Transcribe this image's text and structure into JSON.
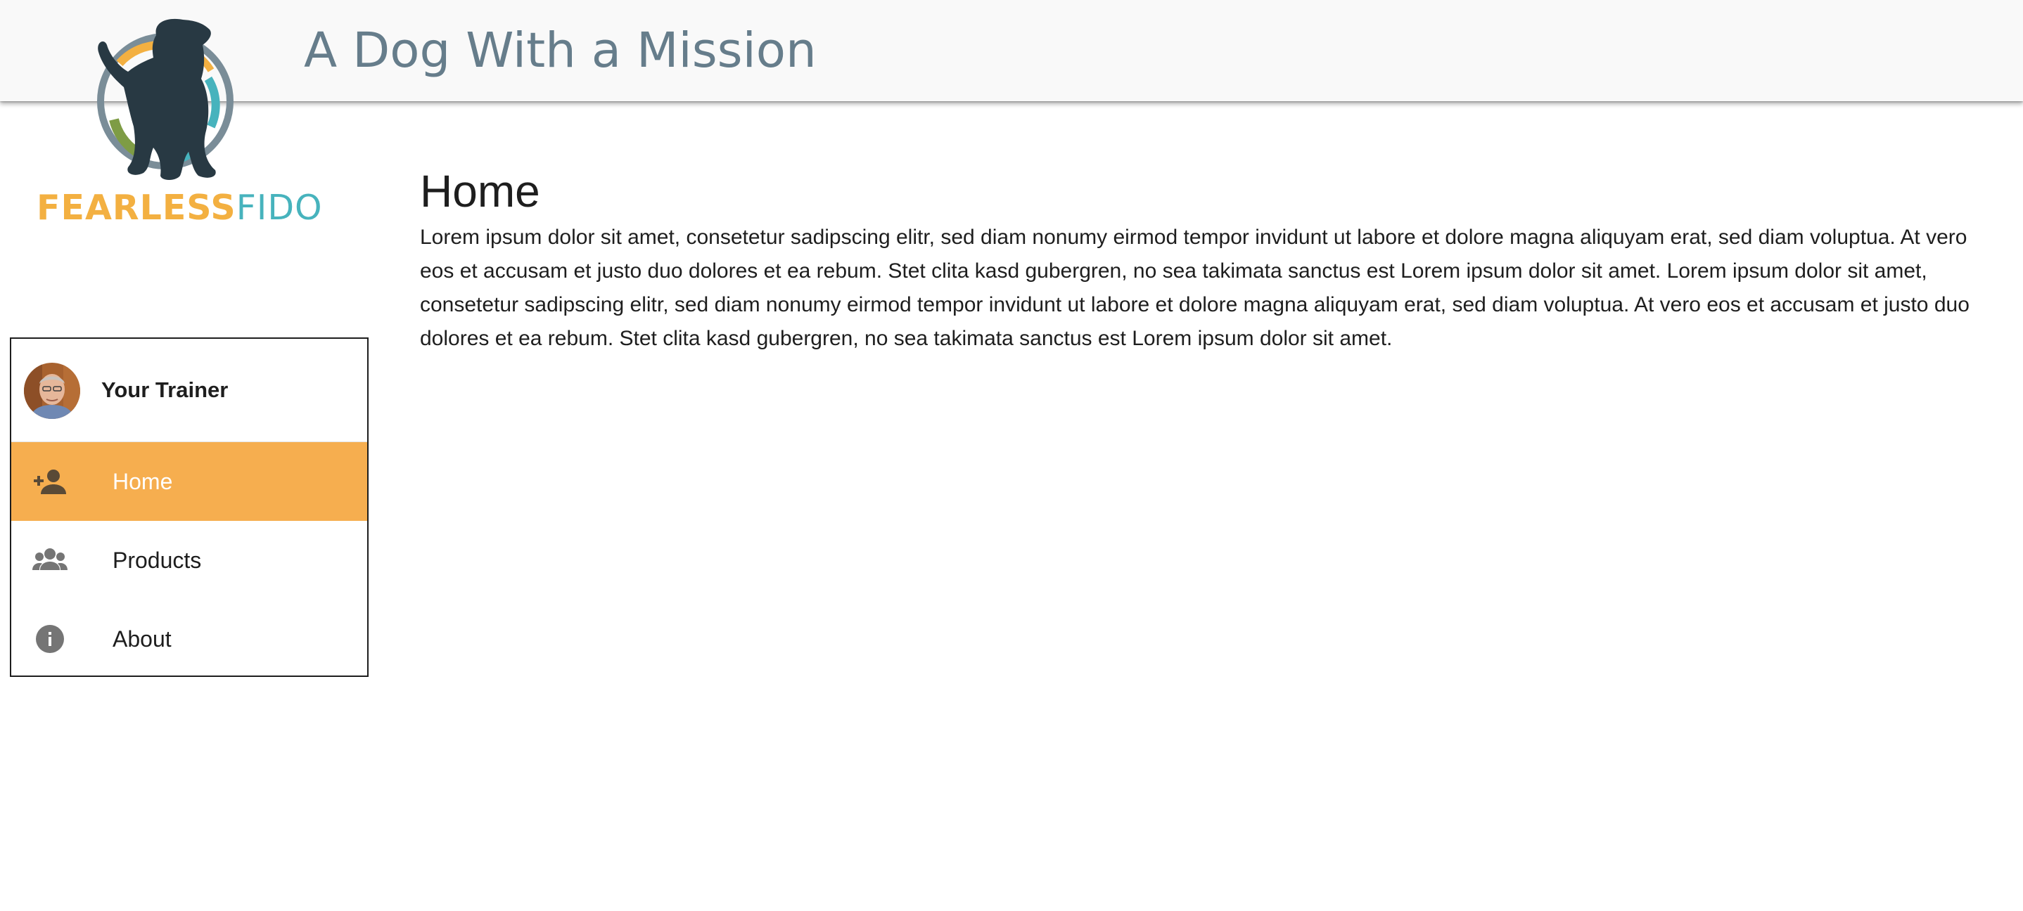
{
  "header": {
    "title": "A Dog With a Mission"
  },
  "logo": {
    "icon": "dog-silhouette-logo-icon",
    "word_fearless": "FEARLESS",
    "word_fido": "FIDO",
    "colors": {
      "dog": "#283943",
      "ring": "#7a8d98",
      "orange": "#f3b041",
      "teal": "#47b3bd",
      "green": "#7e9c45"
    }
  },
  "sidebar": {
    "trainer_label": "Your Trainer",
    "items": [
      {
        "label": "Home",
        "icon": "person-add-icon",
        "active": true
      },
      {
        "label": "Products",
        "icon": "group-icon",
        "active": false
      },
      {
        "label": "About",
        "icon": "info-icon",
        "active": false
      }
    ]
  },
  "main": {
    "title": "Home",
    "body": "Lorem ipsum dolor sit amet, consetetur sadipscing elitr, sed diam nonumy eirmod tempor invidunt ut labore et dolore magna aliquyam erat, sed diam voluptua. At vero eos et accusam et justo duo dolores et ea rebum. Stet clita kasd gubergren, no sea takimata sanctus est Lorem ipsum dolor sit amet. Lorem ipsum dolor sit amet, consetetur sadipscing elitr, sed diam nonumy eirmod tempor invidunt ut labore et dolore magna aliquyam erat, sed diam voluptua. At vero eos et accusam et justo duo dolores et ea rebum. Stet clita kasd gubergren, no sea takimata sanctus est Lorem ipsum dolor sit amet."
  },
  "colors": {
    "header_bg": "#f9f9f9",
    "title_text": "#667d8b",
    "active_nav_bg": "#f6ae4f",
    "icon_gray": "#757575"
  }
}
